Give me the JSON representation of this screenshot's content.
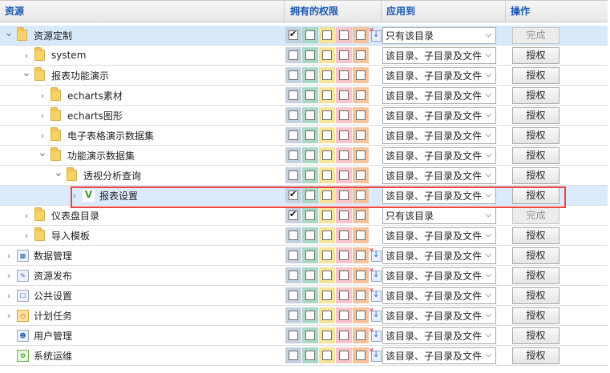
{
  "header": {
    "col_resource": "资源",
    "col_permissions": "拥有的权限",
    "col_apply_to": "应用到",
    "col_action": "操作"
  },
  "rows": [
    {
      "label": "资源定制",
      "icon": "folder-icon",
      "level": 0,
      "expand": "expanded",
      "perms": [
        true,
        false,
        false,
        false,
        false
      ],
      "perm_icon": true,
      "apply": "只有该目录",
      "action": "完成",
      "action_disabled": true,
      "selected": true
    },
    {
      "label": "system",
      "icon": "folder-icon",
      "level": 1,
      "expand": "collapsed",
      "perms": [
        false,
        false,
        false,
        false,
        false
      ],
      "perm_icon": false,
      "apply": "该目录、子目录及文件",
      "action": "授权",
      "action_disabled": false
    },
    {
      "label": "报表功能演示",
      "icon": "folder-icon",
      "level": 1,
      "expand": "expanded",
      "perms": [
        false,
        false,
        false,
        false,
        false
      ],
      "perm_icon": false,
      "apply": "该目录、子目录及文件",
      "action": "授权",
      "action_disabled": false
    },
    {
      "label": "echarts素材",
      "icon": "folder-icon",
      "level": 2,
      "expand": "collapsed",
      "perms": [
        false,
        false,
        false,
        false,
        false
      ],
      "perm_icon": false,
      "apply": "该目录、子目录及文件",
      "action": "授权",
      "action_disabled": false
    },
    {
      "label": "echarts图形",
      "icon": "folder-icon",
      "level": 2,
      "expand": "collapsed",
      "perms": [
        false,
        false,
        false,
        false,
        false
      ],
      "perm_icon": false,
      "apply": "该目录、子目录及文件",
      "action": "授权",
      "action_disabled": false
    },
    {
      "label": "电子表格演示数据集",
      "icon": "folder-icon",
      "level": 2,
      "expand": "collapsed",
      "perms": [
        false,
        false,
        false,
        false,
        false
      ],
      "perm_icon": false,
      "apply": "该目录、子目录及文件",
      "action": "授权",
      "action_disabled": false
    },
    {
      "label": "功能演示数据集",
      "icon": "folder-icon",
      "level": 2,
      "expand": "expanded",
      "perms": [
        false,
        false,
        false,
        false,
        false
      ],
      "perm_icon": false,
      "apply": "该目录、子目录及文件",
      "action": "授权",
      "action_disabled": false
    },
    {
      "label": "透视分析查询",
      "icon": "folder-icon",
      "level": 3,
      "expand": "expanded",
      "perms": [
        false,
        false,
        false,
        false,
        false
      ],
      "perm_icon": false,
      "apply": "该目录、子目录及文件",
      "action": "授权",
      "action_disabled": false
    },
    {
      "label": "报表设置",
      "icon": "report-icon",
      "level": 4,
      "expand": "collapsed",
      "perms": [
        true,
        false,
        false,
        false,
        false
      ],
      "perm_icon": false,
      "apply": "该目录、子目录及文件",
      "action": "授权",
      "action_disabled": false,
      "highlighted": true
    },
    {
      "label": "仪表盘目录",
      "icon": "folder-icon",
      "level": 1,
      "expand": "collapsed",
      "perms": [
        true,
        false,
        false,
        false,
        false
      ],
      "perm_icon": false,
      "apply": "只有该目录",
      "action": "完成",
      "action_disabled": true
    },
    {
      "label": "导入模板",
      "icon": "folder-icon",
      "level": 1,
      "expand": "collapsed",
      "perms": [
        false,
        false,
        false,
        false,
        false
      ],
      "perm_icon": false,
      "apply": "该目录、子目录及文件",
      "action": "授权",
      "action_disabled": false
    },
    {
      "label": "数据管理",
      "icon": "data-management-icon",
      "level": 0,
      "expand": "collapsed",
      "perms": [
        false,
        false,
        false,
        false,
        false
      ],
      "perm_icon": true,
      "apply": "该目录、子目录及文件",
      "action": "授权",
      "action_disabled": false
    },
    {
      "label": "资源发布",
      "icon": "publish-icon",
      "level": 0,
      "expand": "collapsed",
      "perms": [
        false,
        false,
        false,
        false,
        false
      ],
      "perm_icon": true,
      "apply": "该目录、子目录及文件",
      "action": "授权",
      "action_disabled": false
    },
    {
      "label": "公共设置",
      "icon": "settings-icon",
      "level": 0,
      "expand": "collapsed",
      "perms": [
        false,
        false,
        false,
        false,
        false
      ],
      "perm_icon": true,
      "apply": "该目录、子目录及文件",
      "action": "授权",
      "action_disabled": false
    },
    {
      "label": "计划任务",
      "icon": "schedule-icon",
      "level": 0,
      "expand": "collapsed",
      "perms": [
        false,
        false,
        false,
        false,
        false
      ],
      "perm_icon": true,
      "apply": "该目录、子目录及文件",
      "action": "授权",
      "action_disabled": false
    },
    {
      "label": "用户管理",
      "icon": "user-management-icon",
      "level": 0,
      "expand": "none",
      "perms": [
        false,
        false,
        false,
        false,
        false
      ],
      "perm_icon": true,
      "apply": "该目录、子目录及文件",
      "action": "授权",
      "action_disabled": false
    },
    {
      "label": "系统运维",
      "icon": "system-ops-icon",
      "level": 0,
      "expand": "none",
      "perms": [
        false,
        false,
        false,
        false,
        false
      ],
      "perm_icon": true,
      "apply": "该目录、子目录及文件",
      "action": "授权",
      "action_disabled": false
    }
  ]
}
